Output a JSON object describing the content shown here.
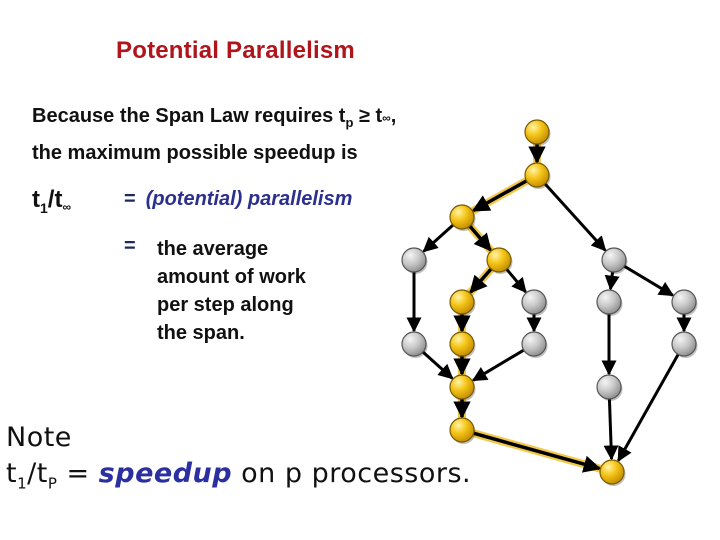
{
  "title": "Potential Parallelism",
  "intro": {
    "line1_prefix": "Because the Span Law requires t",
    "line1_sub": "p",
    "line1_mid": " ≥ t",
    "line1_inf": "∞",
    "line1_suffix": ",",
    "line2": "the maximum possible speedup is"
  },
  "ratio": {
    "t": "t",
    "sub1": "1",
    "slash": "/t",
    "inf": "∞"
  },
  "definitions": [
    {
      "sign": "=",
      "text": "(potential) parallelism"
    },
    {
      "sign": "=",
      "lines": [
        "the average",
        "amount of work",
        "per step along",
        "the span."
      ]
    }
  ],
  "note": {
    "label": "Note",
    "formula_t1": "t",
    "formula_sub1": "1",
    "formula_mid": "/t",
    "formula_subp": "P",
    "formula_eq": " = ",
    "emphasis": "speedup",
    "suffix": " on p processors."
  },
  "colors": {
    "title": "#b0151c",
    "critical_node": "#f5c518",
    "normal_node": "#c8c8c8",
    "critical_highlight": "#f2c94c",
    "emphasis": "#2b2fa0"
  },
  "dag": {
    "nodes": [
      {
        "id": "n1",
        "critical": true
      },
      {
        "id": "n2",
        "critical": true
      },
      {
        "id": "n3",
        "critical": true
      },
      {
        "id": "n4",
        "critical": false
      },
      {
        "id": "n5",
        "critical": true
      },
      {
        "id": "n6",
        "critical": false
      },
      {
        "id": "n7",
        "critical": true
      },
      {
        "id": "n8",
        "critical": false
      },
      {
        "id": "n9",
        "critical": false
      },
      {
        "id": "n10",
        "critical": false
      },
      {
        "id": "n11",
        "critical": false
      },
      {
        "id": "n12",
        "critical": true
      },
      {
        "id": "n13",
        "critical": false
      },
      {
        "id": "n14",
        "critical": false
      },
      {
        "id": "n15",
        "critical": true
      },
      {
        "id": "n16",
        "critical": false
      },
      {
        "id": "n17",
        "critical": true
      },
      {
        "id": "n18",
        "critical": true
      }
    ],
    "edges": [
      {
        "from": "n1",
        "to": "n2",
        "critical": true
      },
      {
        "from": "n2",
        "to": "n3",
        "critical": true
      },
      {
        "from": "n2",
        "to": "n6",
        "critical": false
      },
      {
        "from": "n3",
        "to": "n4",
        "critical": false
      },
      {
        "from": "n3",
        "to": "n5",
        "critical": true
      },
      {
        "from": "n5",
        "to": "n7",
        "critical": true
      },
      {
        "from": "n5",
        "to": "n8",
        "critical": false
      },
      {
        "from": "n6",
        "to": "n9",
        "critical": false
      },
      {
        "from": "n6",
        "to": "n10",
        "critical": false
      },
      {
        "from": "n4",
        "to": "n11",
        "critical": false
      },
      {
        "from": "n7",
        "to": "n12",
        "critical": true
      },
      {
        "from": "n8",
        "to": "n13",
        "critical": false
      },
      {
        "from": "n10",
        "to": "n14",
        "critical": false
      },
      {
        "from": "n11",
        "to": "n15",
        "critical": false
      },
      {
        "from": "n12",
        "to": "n15",
        "critical": true
      },
      {
        "from": "n13",
        "to": "n15",
        "critical": false
      },
      {
        "from": "n9",
        "to": "n16",
        "critical": false
      },
      {
        "from": "n15",
        "to": "n17",
        "critical": true
      },
      {
        "from": "n17",
        "to": "n18",
        "critical": true
      },
      {
        "from": "n16",
        "to": "n18",
        "critical": false
      },
      {
        "from": "n14",
        "to": "n18",
        "critical": false
      }
    ]
  }
}
